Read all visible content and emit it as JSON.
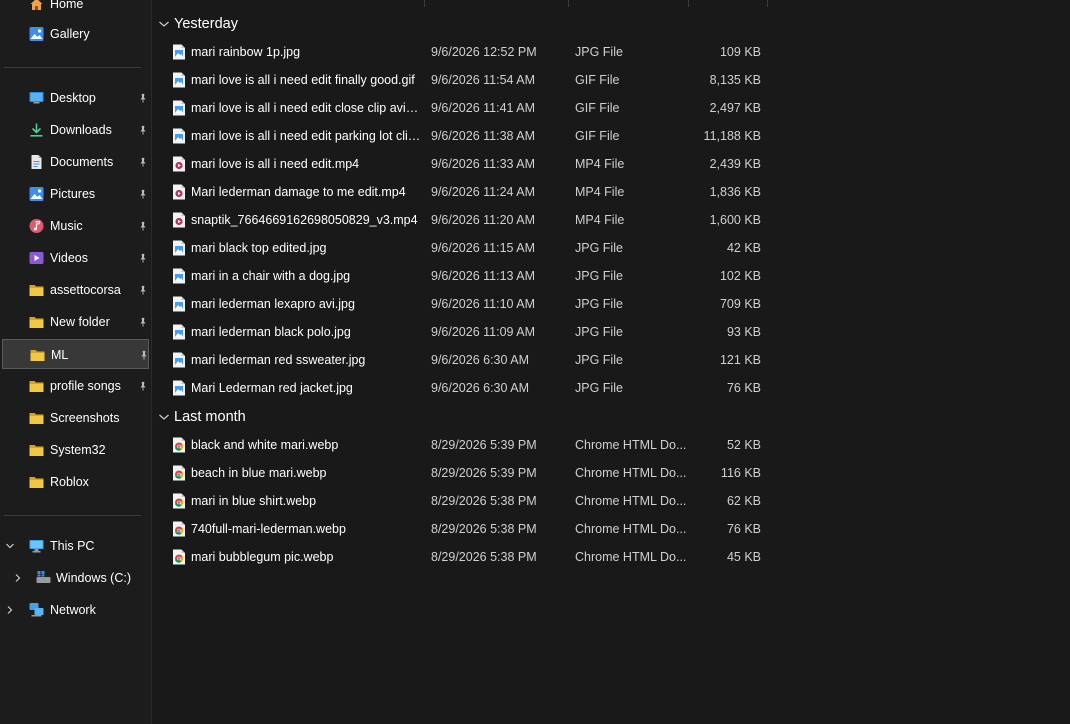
{
  "sidebar": {
    "home": "Home",
    "gallery": "Gallery",
    "quick_access": [
      {
        "label": "Desktop",
        "icon": "desktop-icon"
      },
      {
        "label": "Downloads",
        "icon": "downloads-icon"
      },
      {
        "label": "Documents",
        "icon": "documents-icon"
      },
      {
        "label": "Pictures",
        "icon": "pictures-icon"
      },
      {
        "label": "Music",
        "icon": "music-icon"
      },
      {
        "label": "Videos",
        "icon": "videos-icon"
      },
      {
        "label": "assettocorsa",
        "icon": "folder-icon"
      },
      {
        "label": "New folder",
        "icon": "folder-icon"
      },
      {
        "label": "ML",
        "icon": "folder-icon"
      },
      {
        "label": "profile songs",
        "icon": "folder-icon"
      },
      {
        "label": "Screenshots",
        "icon": "folder-icon"
      },
      {
        "label": "System32",
        "icon": "folder-icon"
      },
      {
        "label": "Roblox",
        "icon": "folder-icon"
      }
    ],
    "selected_index": 8,
    "pinned_count": 10,
    "this_pc": "This PC",
    "drive": "Windows (C:)",
    "network": "Network"
  },
  "groups": [
    {
      "label": "Yesterday",
      "files": [
        {
          "name": "mari rainbow 1p.jpg",
          "date": "9/6/2026 12:52 PM",
          "type": "JPG File",
          "size": "109 KB",
          "kind": "image"
        },
        {
          "name": "mari love is all i need edit finally good.gif",
          "date": "9/6/2026 11:54 AM",
          "type": "GIF File",
          "size": "8,135 KB",
          "kind": "image"
        },
        {
          "name": "mari love is all i need edit close clip avi.gif",
          "date": "9/6/2026 11:41 AM",
          "type": "GIF File",
          "size": "2,497 KB",
          "kind": "image"
        },
        {
          "name": "mari love is all i need edit parking lot clip...",
          "date": "9/6/2026 11:38 AM",
          "type": "GIF File",
          "size": "11,188 KB",
          "kind": "image"
        },
        {
          "name": "mari love is all i need edit.mp4",
          "date": "9/6/2026 11:33 AM",
          "type": "MP4 File",
          "size": "2,439 KB",
          "kind": "video"
        },
        {
          "name": "Mari lederman damage to me edit.mp4",
          "date": "9/6/2026 11:24 AM",
          "type": "MP4 File",
          "size": "1,836 KB",
          "kind": "video"
        },
        {
          "name": "snaptik_7664669162698050829_v3.mp4",
          "date": "9/6/2026 11:20 AM",
          "type": "MP4 File",
          "size": "1,600 KB",
          "kind": "video"
        },
        {
          "name": "mari black top edited.jpg",
          "date": "9/6/2026 11:15 AM",
          "type": "JPG File",
          "size": "42 KB",
          "kind": "image"
        },
        {
          "name": "mari in a chair with a dog.jpg",
          "date": "9/6/2026 11:13 AM",
          "type": "JPG File",
          "size": "102 KB",
          "kind": "image"
        },
        {
          "name": "mari lederman lexapro avi.jpg",
          "date": "9/6/2026 11:10 AM",
          "type": "JPG File",
          "size": "709 KB",
          "kind": "image"
        },
        {
          "name": "mari lederman black polo.jpg",
          "date": "9/6/2026 11:09 AM",
          "type": "JPG File",
          "size": "93 KB",
          "kind": "image"
        },
        {
          "name": "mari lederman red ssweater.jpg",
          "date": "9/6/2026 6:30 AM",
          "type": "JPG File",
          "size": "121 KB",
          "kind": "image"
        },
        {
          "name": "Mari Lederman red jacket.jpg",
          "date": "9/6/2026 6:30 AM",
          "type": "JPG File",
          "size": "76 KB",
          "kind": "image"
        }
      ]
    },
    {
      "label": "Last month",
      "files": [
        {
          "name": "black and white mari.webp",
          "date": "8/29/2026 5:39 PM",
          "type": "Chrome HTML Do...",
          "size": "52 KB",
          "kind": "chrome"
        },
        {
          "name": "beach in blue mari.webp",
          "date": "8/29/2026 5:39 PM",
          "type": "Chrome HTML Do...",
          "size": "116 KB",
          "kind": "chrome"
        },
        {
          "name": "mari in blue shirt.webp",
          "date": "8/29/2026 5:38 PM",
          "type": "Chrome HTML Do...",
          "size": "62 KB",
          "kind": "chrome"
        },
        {
          "name": "740full-mari-lederman.webp",
          "date": "8/29/2026 5:38 PM",
          "type": "Chrome HTML Do...",
          "size": "76 KB",
          "kind": "chrome"
        },
        {
          "name": "mari bubblegum pic.webp",
          "date": "8/29/2026 5:38 PM",
          "type": "Chrome HTML Do...",
          "size": "45 KB",
          "kind": "chrome"
        }
      ]
    }
  ],
  "colors": {
    "background": "#191919",
    "sidebar_background": "#1c1c1c",
    "selected_background": "#383838",
    "folder_yellow": "#f2c744",
    "accent_blue": "#4aa3f0",
    "muted_text": "#d0d0d0"
  }
}
